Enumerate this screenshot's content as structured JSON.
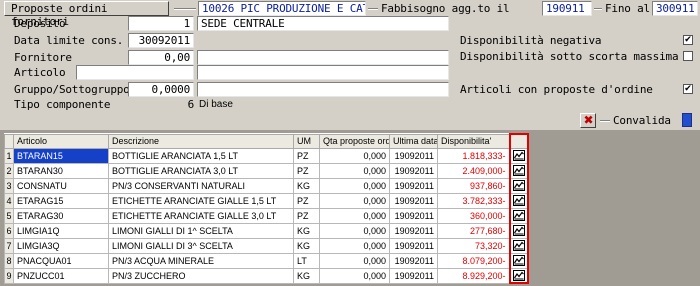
{
  "header": {
    "tab_label": "Proposte ordini fornitori",
    "code": "10026 PIC PRODUZIONE E CAT",
    "fabbisogno_label": "Fabbisogno agg.to il",
    "fabbisogno_date": "190911",
    "fino_label": "Fino al",
    "fino_date": "300911"
  },
  "form": {
    "deposito_label": "Deposito",
    "deposito_num": "1",
    "deposito_name": "SEDE CENTRALE",
    "data_limite_label": "Data limite cons.",
    "data_limite_value": "30092011",
    "fornitore_label": "Fornitore",
    "fornitore_value": "0,00",
    "articolo_label": "Articolo",
    "articolo_value": "",
    "gruppo_label": "Gruppo/Sottogruppo",
    "gruppo_value": "0,0000",
    "tipo_label": "Tipo componente",
    "tipo_num": "6",
    "tipo_desc": "Di base"
  },
  "options": {
    "disp_negativa_label": "Disponibilità negativa",
    "disp_negativa_checked": "✔",
    "disp_sotto_label": "Disponibilità sotto scorta massima",
    "disp_sotto_checked": "",
    "articoli_label": "Articoli con proposte d'ordine",
    "articoli_checked": "✔",
    "convalida_label": "Convalida",
    "close_icon": "close-icon"
  },
  "grid": {
    "columns": [
      "Articolo",
      "Descrizione",
      "UM",
      "Qta proposte ordini",
      "Ultima data",
      "Disponibilita'"
    ],
    "rows": [
      {
        "n": "1",
        "art": "BTARAN15",
        "desc": "BOTTIGLIE ARANCIATA 1,5 LT",
        "um": "PZ",
        "qta": "0,000",
        "data": "19092011",
        "disp": "1.818,333-"
      },
      {
        "n": "2",
        "art": "BTARAN30",
        "desc": "BOTTIGLIE ARANCIATA 3,0 LT",
        "um": "PZ",
        "qta": "0,000",
        "data": "19092011",
        "disp": "2.409,000-"
      },
      {
        "n": "3",
        "art": "CONSNATU",
        "desc": "PN/3 CONSERVANTI NATURALI",
        "um": "KG",
        "qta": "0,000",
        "data": "19092011",
        "disp": "937,860-"
      },
      {
        "n": "4",
        "art": "ETARAG15",
        "desc": "ETICHETTE ARANCIATE GIALLE 1,5 LT",
        "um": "PZ",
        "qta": "0,000",
        "data": "19092011",
        "disp": "3.782,333-"
      },
      {
        "n": "5",
        "art": "ETARAG30",
        "desc": "ETICHETTE ARANCIATE GIALLE 3,0 LT",
        "um": "PZ",
        "qta": "0,000",
        "data": "19092011",
        "disp": "360,000-"
      },
      {
        "n": "6",
        "art": "LIMGIA1Q",
        "desc": "LIMONI GIALLI DI 1^ SCELTA",
        "um": "KG",
        "qta": "0,000",
        "data": "19092011",
        "disp": "277,680-"
      },
      {
        "n": "7",
        "art": "LIMGIA3Q",
        "desc": "LIMONI GIALLI DI 3^ SCELTA",
        "um": "KG",
        "qta": "0,000",
        "data": "19092011",
        "disp": "73,320-"
      },
      {
        "n": "8",
        "art": "PNACQUA01",
        "desc": "PN/3 ACQUA MINERALE",
        "um": "LT",
        "qta": "0,000",
        "data": "19092011",
        "disp": "8.079,200-"
      },
      {
        "n": "9",
        "art": "PNZUCC01",
        "desc": "PN/3 ZUCCHERO",
        "um": "KG",
        "qta": "0,000",
        "data": "19092011",
        "disp": "8.929,200-"
      }
    ]
  }
}
